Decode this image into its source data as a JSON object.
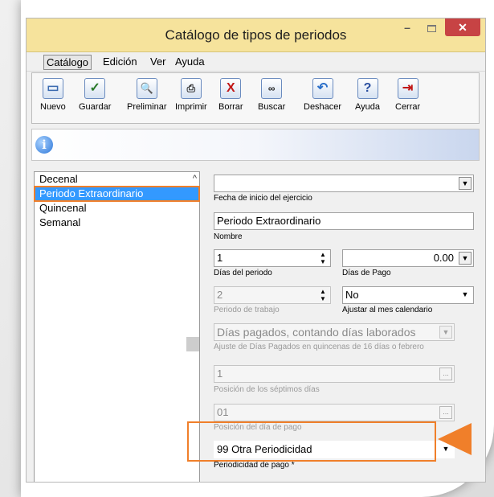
{
  "window": {
    "title": "Catálogo de tipos de periodos",
    "min_glyph": "–",
    "close_glyph": "✕"
  },
  "menu": [
    {
      "label": "Catálogo"
    },
    {
      "label": "Edición"
    },
    {
      "label": "Ver"
    },
    {
      "label": "Ayuda"
    }
  ],
  "toolbar": [
    {
      "label": "Nuevo",
      "icon": "new-document-icon"
    },
    {
      "label": "Guardar",
      "icon": "checkmark-icon"
    },
    {
      "label": "Preliminar",
      "icon": "print-preview-icon"
    },
    {
      "label": "Imprimir",
      "icon": "printer-icon"
    },
    {
      "label": "Borrar",
      "icon": "delete-x-icon"
    },
    {
      "label": "Buscar",
      "icon": "binoculars-icon"
    },
    {
      "label": "Deshacer",
      "icon": "undo-icon"
    },
    {
      "label": "Ayuda",
      "icon": "help-icon"
    },
    {
      "label": "Cerrar",
      "icon": "exit-icon"
    }
  ],
  "list": {
    "items": [
      "Decenal",
      "Periodo Extraordinario",
      "Quincenal",
      "Semanal"
    ],
    "selected_index": 1
  },
  "form": {
    "fecha_inicio": {
      "value": "",
      "label": "Fecha de inicio del ejercicio"
    },
    "nombre": {
      "value": "Periodo Extraordinario",
      "label": "Nombre"
    },
    "dias_periodo": {
      "value": "1",
      "label": "Días del periodo"
    },
    "dias_pago": {
      "value": "0.00",
      "label": "Días de Pago"
    },
    "periodo_trabajo": {
      "value": "2",
      "label": "Periodo de trabajo"
    },
    "ajustar_mes": {
      "value": "No",
      "label": "Ajustar al mes calendario"
    },
    "ajuste_dias": {
      "value": "Días pagados, contando días laborados",
      "label": "Ajuste de Días Pagados en quincenas de 16 días o febrero"
    },
    "posicion_septimos": {
      "value": "1",
      "label": "Posición de los séptimos días"
    },
    "posicion_pago": {
      "value": "01",
      "label": "Posición del día de pago"
    },
    "periodicidad": {
      "value": "99 Otra Periodicidad",
      "label": "Periodicidad de pago *"
    }
  },
  "colors": {
    "titlebar": "#f6e39c",
    "selection": "#3399ff",
    "highlight": "#f07f2a",
    "close": "#c74344"
  }
}
